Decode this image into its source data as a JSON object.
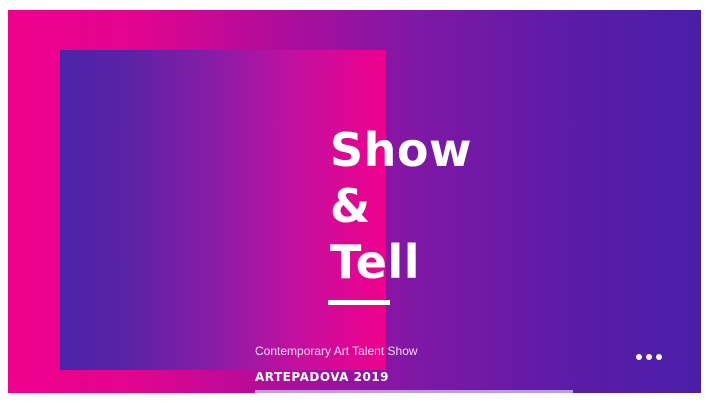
{
  "slide": {
    "title_lines": [
      "Show",
      "&",
      "Tell"
    ],
    "subtitle": "Contemporary Art Talent Show",
    "event": "ARTEPADOVA 2019"
  },
  "controls": {
    "more_icon": "more-horizontal-icon"
  },
  "colors": {
    "background_left": "#ef008c",
    "background_right": "#4b1ea8",
    "panel_left": "#4a24a8",
    "panel_right": "#ef008c",
    "text": "#ffffff"
  }
}
